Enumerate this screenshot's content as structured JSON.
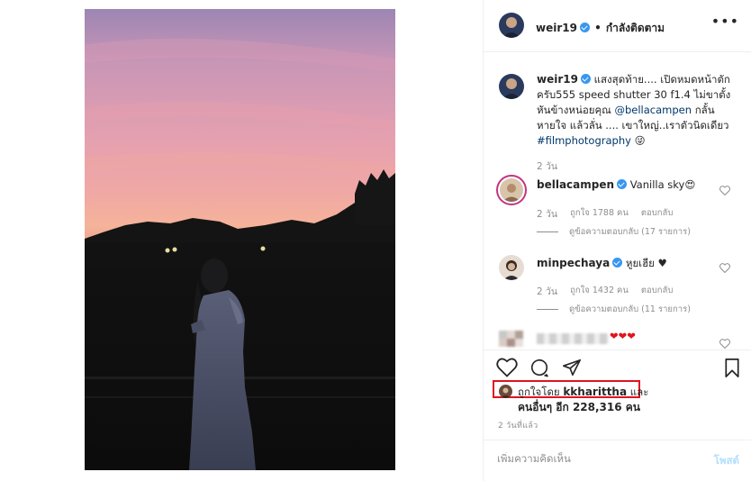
{
  "post": {
    "author": "weir19",
    "follow_separator": "•",
    "follow_state": "กำลังติดตาม",
    "more_icon": "more-horizontal-icon"
  },
  "caption": {
    "author": "weir19",
    "text_before_mention": " แสงสุดท้าย.... เปิดหมดหน้าตัก ครับ555 speed shutter 30 f1.4 ไม่ขาตั้ง หันข้างหน่อยคุณ ",
    "mention": "@bellacampen",
    "text_after_mention": " กลั้นหายใจ แล้วลั่น .... เขาใหญ่..เราตัวนิดเดียว ",
    "hashtag": "#filmphotography",
    "emoji": "😜",
    "time": "2 วัน"
  },
  "comments": [
    {
      "user": "bellacampen",
      "text": "Vanilla sky😍",
      "time": "2 วัน",
      "likes": "ถูกใจ 1788 คน",
      "reply_label": "ตอบกลับ",
      "view_replies": "ดูข้อความตอบกลับ (17 รายการ)"
    },
    {
      "user": "minpechaya",
      "text": "หูยเฮีย ♥",
      "time": "2 วัน",
      "likes": "ถูกใจ 1432 คน",
      "reply_label": "ตอบกลับ",
      "view_replies": "ดูข้อความตอบกลับ (11 รายการ)"
    },
    {
      "user": "",
      "text": "❤❤❤",
      "time": "",
      "likes": "",
      "reply_label": "",
      "view_replies": ""
    }
  ],
  "engagement": {
    "liked_by_prefix": "ถูกใจโดย",
    "liked_by_user": "kkharittha",
    "liked_by_and": "และ",
    "others_prefix": "คนอื่นๆ อีก",
    "others_count": "228,316",
    "others_suffix": "คน",
    "time_ago": "2 วันที่แล้ว"
  },
  "add_comment": {
    "placeholder": "เพิ่มความคิดเห็น",
    "post_label": "โพสต์"
  },
  "colors": {
    "verified": "#3897f0",
    "link": "#00376b",
    "muted": "#8e8e8e",
    "post_disabled": "#b2dffc",
    "highlight_box": "#e0141e",
    "heart_red": "#ed4956"
  },
  "icons": [
    "heart-icon",
    "comment-icon",
    "share-icon",
    "bookmark-icon",
    "verified-badge-icon"
  ]
}
